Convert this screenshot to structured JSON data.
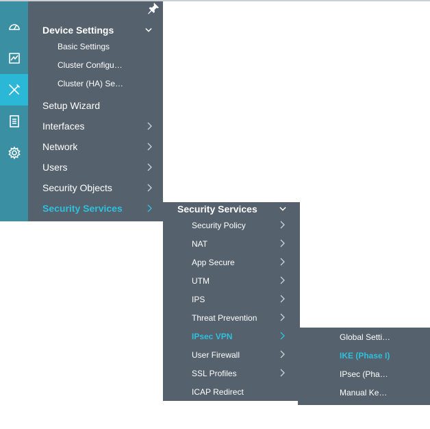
{
  "rail": {
    "items": [
      {
        "name": "dashboard-icon"
      },
      {
        "name": "monitor-icon"
      },
      {
        "name": "configure-icon",
        "active": true
      },
      {
        "name": "reports-icon"
      },
      {
        "name": "administration-icon"
      }
    ]
  },
  "menu1": {
    "header": "Device Settings",
    "sub_items": [
      "Basic Settings",
      "Cluster Configu…",
      "Cluster (HA) Se…"
    ],
    "items": [
      {
        "label": "Setup Wizard",
        "chevron": false
      },
      {
        "label": "Interfaces",
        "chevron": true
      },
      {
        "label": "Network",
        "chevron": true
      },
      {
        "label": "Users",
        "chevron": true
      },
      {
        "label": "Security Objects",
        "chevron": true
      },
      {
        "label": "Security Services",
        "chevron": true,
        "active": true
      }
    ]
  },
  "menu2": {
    "header": "Security Services",
    "items": [
      {
        "label": "Security Policy",
        "chevron": true
      },
      {
        "label": "NAT",
        "chevron": true
      },
      {
        "label": "App Secure",
        "chevron": true
      },
      {
        "label": "UTM",
        "chevron": true
      },
      {
        "label": "IPS",
        "chevron": true
      },
      {
        "label": "Threat Prevention",
        "chevron": true
      },
      {
        "label": "IPsec VPN",
        "chevron": true,
        "active": true
      },
      {
        "label": "User Firewall",
        "chevron": true
      },
      {
        "label": "SSL Profiles",
        "chevron": true
      },
      {
        "label": "ICAP Redirect",
        "chevron": false
      }
    ]
  },
  "menu3": {
    "items": [
      {
        "label": "Global Setti…"
      },
      {
        "label": "IKE (Phase I)",
        "active": true
      },
      {
        "label": "IPsec (Pha…"
      },
      {
        "label": "Manual Ke…"
      }
    ]
  },
  "colors": {
    "rail": "#3a8fa3",
    "rail_active": "#2bb7d6",
    "panel": "#55616c",
    "accent": "#2ec0dd",
    "text": "#ffffff"
  }
}
